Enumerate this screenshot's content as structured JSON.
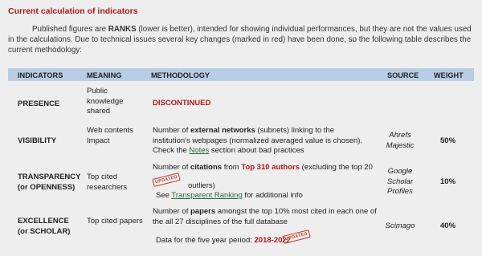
{
  "title": "Current calculation of indicators",
  "intro": {
    "t1": "Published figures are ",
    "bold1": "RANKS",
    "t2": " (lower is better), intended for showing individual performances, but they are not the values used in the calculations. Due to technical issues several key changes (marked in red) have been done, so the following table describes the current methodology:"
  },
  "headers": {
    "indicators": "INDICATORS",
    "meaning": "MEANING",
    "methodology": "METHODOLOGY",
    "source": "SOURCE",
    "weight": "WEIGHT"
  },
  "rows": {
    "presence": {
      "indicator": "PRESENCE",
      "meaning": "Public knowledge shared",
      "methodology": "DISCONTINUED"
    },
    "visibility": {
      "indicator": "VISIBILITY",
      "meaning": "Web contents Impact",
      "m1": "Number of ",
      "mbold": "external networks",
      "m2": " (subnets) linking to the institution's webpages (normalized averaged value is chosen). Check the ",
      "mlink": "Notes",
      "m3": " section about bad practices",
      "source": "Ahrefs Majestic",
      "weight": "50%"
    },
    "transparency": {
      "indicator1": "TRANSPARENCY",
      "indicator2": "(or OPENNESS)",
      "meaning": "Top cited researchers",
      "m1": "Number of ",
      "mbold1": "citations",
      "m2": " from ",
      "mred": "Top 310 authors",
      "m3": " (excluding the top 20",
      "m4": "outliers)",
      "stamp": "UPDATED",
      "m5": "See ",
      "mlink": "Transparent Ranking",
      "m6": " for additional info",
      "source": "Google Scholar Profiles",
      "weight": "10%"
    },
    "excellence": {
      "indicator1": "EXCELLENCE",
      "indicator2": "(or SCHOLAR)",
      "meaning": "Top cited papers",
      "m1": "Number of ",
      "mbold": "papers",
      "m2": " amongst the top 10% most cited in each one of the all 27 disciplines of the full database",
      "m3": "Data for the five year period: ",
      "mred": "2018-2022",
      "stamp": "UPDATED",
      "source": "Scimago",
      "weight": "40%"
    }
  },
  "colors": {
    "title_red": "#b01818",
    "header_bg": "#b8cde6",
    "link_green": "#2a6a3a",
    "background": "#eeeeee"
  }
}
